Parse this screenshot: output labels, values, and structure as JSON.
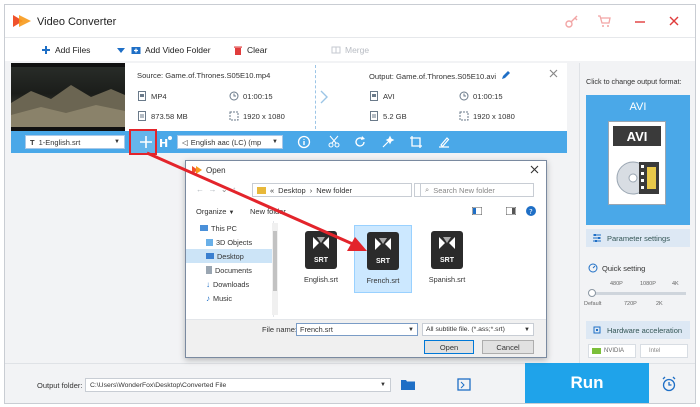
{
  "app": {
    "title": "Video Converter"
  },
  "toolbar": {
    "add_files": "Add Files",
    "add_video_folder": "Add Video Folder",
    "clear": "Clear",
    "merge": "Merge"
  },
  "source": {
    "label": "Source: Game.of.Thrones.S05E10.mp4",
    "format": "MP4",
    "duration": "01:00:15",
    "size": "873.58 MB",
    "resolution": "1920 x 1080"
  },
  "output": {
    "label": "Output: Game.of.Thrones.S05E10.avi",
    "format": "AVI",
    "duration": "01:00:15",
    "size": "5.2 GB",
    "resolution": "1920 x 1080"
  },
  "subtitle_select": "1-English.srt",
  "audio_select": "English aac (LC) (mp",
  "right_panel": {
    "hint": "Click to change output format:",
    "format_name": "AVI",
    "format_badge": "AVI",
    "parameter_settings": "Parameter settings",
    "quick_setting": "Quick setting",
    "quality_top": [
      "480P",
      "1080P",
      "4K"
    ],
    "quality_bottom": [
      "Default",
      "720P",
      "2K"
    ],
    "hardware_acceleration": "Hardware acceleration",
    "nvidia": "NVIDIA",
    "intel": "Intel"
  },
  "bottom": {
    "output_folder_label": "Output folder:",
    "output_folder_path": "C:\\Users\\WonderFox\\Desktop\\Converted File",
    "run": "Run"
  },
  "dialog": {
    "title": "Open",
    "breadcrumb": [
      "Desktop",
      "New folder"
    ],
    "search_placeholder": "Search New folder",
    "organize": "Organize",
    "new_folder": "New folder",
    "nav": [
      "This PC",
      "3D Objects",
      "Desktop",
      "Documents",
      "Downloads",
      "Music"
    ],
    "files": [
      {
        "name": "English.srt",
        "badge": "SRT"
      },
      {
        "name": "French.srt",
        "badge": "SRT"
      },
      {
        "name": "Spanish.srt",
        "badge": "SRT"
      }
    ],
    "file_name_label": "File name:",
    "file_name_value": "French.srt",
    "file_type": "All subtitle file. (*.ass;*.srt)",
    "open": "Open",
    "cancel": "Cancel"
  },
  "colors": {
    "accent": "#1fa3ea",
    "bar": "#4aa8e8",
    "highlight": "#e3242b"
  }
}
